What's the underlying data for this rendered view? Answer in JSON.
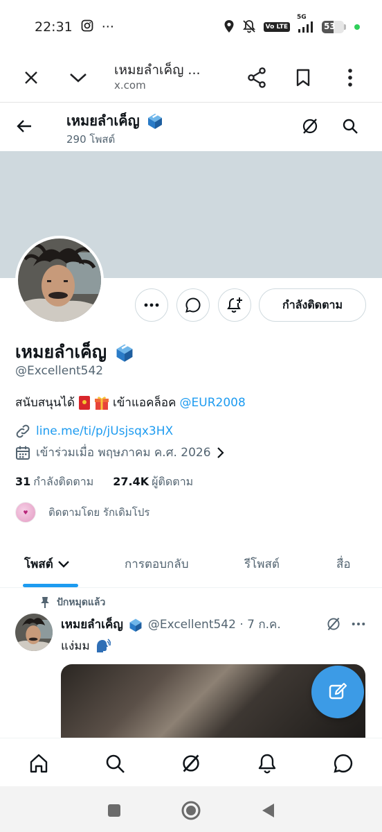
{
  "status_bar": {
    "time": "22:31",
    "dots": "···",
    "net_badge": "Vo LTE",
    "net_type": "5G",
    "battery": "53",
    "battery_level": 0.53
  },
  "browser": {
    "title": "เหมยลำเค็ญ ...",
    "url": "x.com"
  },
  "profile_header": {
    "name": "เหมยลำเค็ญ",
    "post_count": "290 โพสต์"
  },
  "profile": {
    "name": "เหมยลำเค็ญ",
    "handle": "@Excellent542",
    "bio_text_1": "สนับสนุนได้",
    "bio_text_2": "เข้าแอคล็อค",
    "bio_mention": "@EUR2008",
    "link": "line.me/ti/p/jUsjsqx3HX",
    "joined": "เข้าร่วมเมื่อ พฤษภาคม ค.ศ. 2026",
    "following_btn": "กำลังติดตาม",
    "following_count": "31",
    "following_label": "กำลังติดตาม",
    "followers_count": "27.4K",
    "followers_label": "ผู้ติดตาม",
    "followed_by": "ติดตามโดย รักเดิมโปร"
  },
  "tabs": [
    {
      "label": "โพสต์"
    },
    {
      "label": "การตอบกลับ"
    },
    {
      "label": "รีโพสต์"
    },
    {
      "label": "สื่อ"
    }
  ],
  "post": {
    "pinned_label": "ปักหมุดแล้ว",
    "name": "เหมยลำเค็ญ",
    "meta": "@Excellent542 · 7 ก.ค.",
    "text": "แง่มม"
  },
  "colors": {
    "accent": "#1d9bf0",
    "banner": "#cfd9de",
    "fab": "#3c9be6"
  }
}
